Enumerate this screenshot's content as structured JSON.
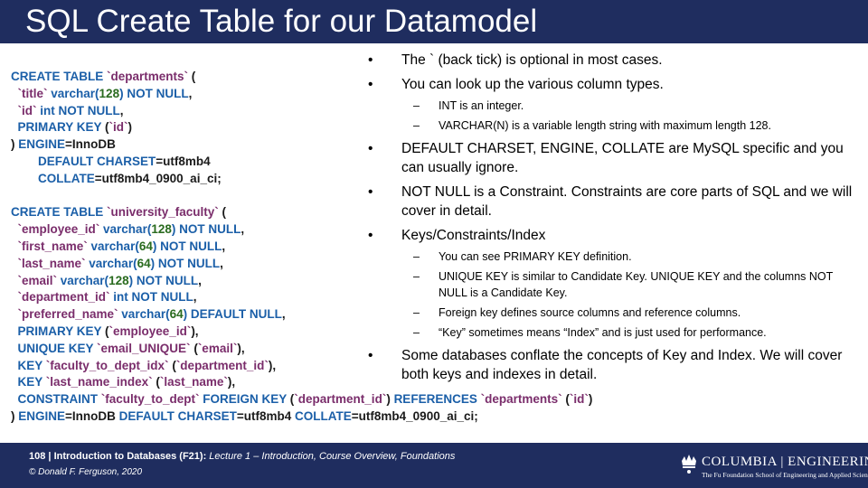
{
  "slide": {
    "title": "SQL Create Table for our Datamodel"
  },
  "code": {
    "lines": [
      [
        [
          "k",
          "CREATE TABLE "
        ],
        [
          "s",
          "`departments`"
        ],
        [
          "t",
          " ("
        ]
      ],
      [
        [
          "s",
          "  `title` "
        ],
        [
          "k",
          "varchar("
        ],
        [
          "n",
          "128"
        ],
        [
          "k",
          ") NOT NULL"
        ],
        [
          "t",
          ","
        ]
      ],
      [
        [
          "s",
          "  `id` "
        ],
        [
          "k",
          "int NOT NULL"
        ],
        [
          "t",
          ","
        ]
      ],
      [
        [
          "k",
          "  PRIMARY KEY "
        ],
        [
          "t",
          "("
        ],
        [
          "s",
          "`id`"
        ],
        [
          "t",
          ")"
        ]
      ],
      [
        [
          "t",
          ") "
        ],
        [
          "k",
          "ENGINE"
        ],
        [
          "t",
          "=InnoDB"
        ]
      ],
      [
        [
          "k",
          "        DEFAULT CHARSET"
        ],
        [
          "t",
          "=utf8mb4"
        ]
      ],
      [
        [
          "k",
          "        COLLATE"
        ],
        [
          "t",
          "=utf8mb4_0900_ai_ci;"
        ]
      ],
      [
        [
          "t",
          " "
        ]
      ],
      [
        [
          "k",
          "CREATE TABLE "
        ],
        [
          "s",
          "`university_faculty`"
        ],
        [
          "t",
          " ("
        ]
      ],
      [
        [
          "s",
          "  `employee_id` "
        ],
        [
          "k",
          "varchar("
        ],
        [
          "n",
          "128"
        ],
        [
          "k",
          ") NOT NULL"
        ],
        [
          "t",
          ","
        ]
      ],
      [
        [
          "s",
          "  `first_name` "
        ],
        [
          "k",
          "varchar("
        ],
        [
          "n",
          "64"
        ],
        [
          "k",
          ") NOT NULL"
        ],
        [
          "t",
          ","
        ]
      ],
      [
        [
          "s",
          "  `last_name` "
        ],
        [
          "k",
          "varchar("
        ],
        [
          "n",
          "64"
        ],
        [
          "k",
          ") NOT NULL"
        ],
        [
          "t",
          ","
        ]
      ],
      [
        [
          "s",
          "  `email` "
        ],
        [
          "k",
          "varchar("
        ],
        [
          "n",
          "128"
        ],
        [
          "k",
          ") NOT NULL"
        ],
        [
          "t",
          ","
        ]
      ],
      [
        [
          "s",
          "  `department_id` "
        ],
        [
          "k",
          "int NOT NULL"
        ],
        [
          "t",
          ","
        ]
      ],
      [
        [
          "s",
          "  `preferred_name` "
        ],
        [
          "k",
          "varchar("
        ],
        [
          "n",
          "64"
        ],
        [
          "k",
          ") DEFAULT NULL"
        ],
        [
          "t",
          ","
        ]
      ],
      [
        [
          "k",
          "  PRIMARY KEY "
        ],
        [
          "t",
          "("
        ],
        [
          "s",
          "`employee_id`"
        ],
        [
          "t",
          "),"
        ]
      ],
      [
        [
          "k",
          "  UNIQUE KEY "
        ],
        [
          "s",
          "`email_UNIQUE`"
        ],
        [
          "t",
          " ("
        ],
        [
          "s",
          "`email`"
        ],
        [
          "t",
          "),"
        ]
      ],
      [
        [
          "k",
          "  KEY "
        ],
        [
          "s",
          "`faculty_to_dept_idx`"
        ],
        [
          "t",
          " ("
        ],
        [
          "s",
          "`department_id`"
        ],
        [
          "t",
          "),"
        ]
      ],
      [
        [
          "k",
          "  KEY "
        ],
        [
          "s",
          "`last_name_index`"
        ],
        [
          "t",
          " ("
        ],
        [
          "s",
          "`last_name`"
        ],
        [
          "t",
          "),"
        ]
      ],
      [
        [
          "k",
          "  CONSTRAINT "
        ],
        [
          "s",
          "`faculty_to_dept`"
        ],
        [
          "k",
          " FOREIGN KEY "
        ],
        [
          "t",
          "("
        ],
        [
          "s",
          "`department_id`"
        ],
        [
          "t",
          ") "
        ],
        [
          "k",
          "REFERENCES "
        ],
        [
          "s",
          "`departments`"
        ],
        [
          "t",
          " ("
        ],
        [
          "s",
          "`id`"
        ],
        [
          "t",
          ")"
        ]
      ],
      [
        [
          "t",
          ") "
        ],
        [
          "k",
          "ENGINE"
        ],
        [
          "t",
          "=InnoDB "
        ],
        [
          "k",
          "DEFAULT CHARSET"
        ],
        [
          "t",
          "=utf8mb4 "
        ],
        [
          "k",
          "COLLATE"
        ],
        [
          "t",
          "=utf8mb4_0900_ai_ci;"
        ]
      ]
    ]
  },
  "bullets": [
    {
      "level": 1,
      "text": "The ` (back tick) is optional in most cases."
    },
    {
      "level": 1,
      "text": "You can look up the various column types."
    },
    {
      "level": 2,
      "text": "INT is an integer."
    },
    {
      "level": 2,
      "text": "VARCHAR(N) is a variable length string with maximum length 128."
    },
    {
      "level": 1,
      "text": "DEFAULT CHARSET, ENGINE, COLLATE are MySQL specific and you can usually ignore."
    },
    {
      "level": 1,
      "text": "NOT NULL is a Constraint. Constraints are core parts of SQL and we will cover in detail."
    },
    {
      "level": 1,
      "text": "Keys/Constraints/Index"
    },
    {
      "level": 2,
      "text": "You can see PRIMARY KEY definition."
    },
    {
      "level": 2,
      "text": "UNIQUE KEY is similar to Candidate Key. UNIQUE KEY and the columns NOT NULL is a Candidate Key."
    },
    {
      "level": 2,
      "text": "Foreign key defines source columns and reference columns."
    },
    {
      "level": 2,
      "text": "“Key” sometimes means “Index” and is just used for performance."
    },
    {
      "level": 1,
      "text": "Some databases conflate the concepts of Key and Index. We will cover both keys and indexes in detail."
    }
  ],
  "footer": {
    "page_number": "108",
    "separator": " | ",
    "course": "Introduction to Databases (F21):",
    "lecture": " Lecture 1 – Introduction, Course Overview, Foundations",
    "copyright": "© Donald F. Ferguson, 2020",
    "logo_name": "COLUMBIA | ENGINEERING",
    "logo_subtitle": "The Fu Foundation School of Engineering and Applied Science",
    "logo_icon": "crown-icon"
  },
  "colors": {
    "bar": "#1f2d5f",
    "keyword": "#1b5fa8",
    "identifier": "#7a2d6b",
    "number": "#2a6b1f"
  }
}
